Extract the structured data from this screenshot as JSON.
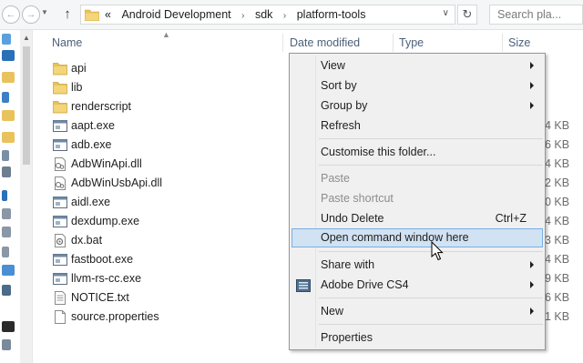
{
  "toolbar": {
    "back_glyph": "←",
    "forward_glyph": "→",
    "up_glyph": "↑",
    "breadcrumb_prefix": "«",
    "breadcrumbs": [
      "Android Development",
      "sdk",
      "platform-tools"
    ],
    "search_placeholder": "Search pla..."
  },
  "columns": {
    "name": "Name",
    "date": "Date modified",
    "type": "Type",
    "size": "Size"
  },
  "files": [
    {
      "name": "api",
      "kind": "folder",
      "size": ""
    },
    {
      "name": "lib",
      "kind": "folder",
      "size": ""
    },
    {
      "name": "renderscript",
      "kind": "folder",
      "size": ""
    },
    {
      "name": "aapt.exe",
      "kind": "exe",
      "size": "4 KB"
    },
    {
      "name": "adb.exe",
      "kind": "exe",
      "size": "6 KB"
    },
    {
      "name": "AdbWinApi.dll",
      "kind": "dll",
      "size": "4 KB"
    },
    {
      "name": "AdbWinUsbApi.dll",
      "kind": "dll",
      "size": "2 KB"
    },
    {
      "name": "aidl.exe",
      "kind": "exe",
      "size": "0 KB"
    },
    {
      "name": "dexdump.exe",
      "kind": "exe",
      "size": "4 KB"
    },
    {
      "name": "dx.bat",
      "kind": "bat",
      "size": "3 KB"
    },
    {
      "name": "fastboot.exe",
      "kind": "exe",
      "size": "4 KB"
    },
    {
      "name": "llvm-rs-cc.exe",
      "kind": "exe",
      "size": "9 KB"
    },
    {
      "name": "NOTICE.txt",
      "kind": "txt",
      "size": "6 KB"
    },
    {
      "name": "source.properties",
      "kind": "file",
      "size": "1 KB"
    }
  ],
  "context_menu": {
    "view": "View",
    "sort_by": "Sort by",
    "group_by": "Group by",
    "refresh": "Refresh",
    "customise": "Customise this folder...",
    "paste": "Paste",
    "paste_shortcut": "Paste shortcut",
    "undo_delete": "Undo Delete",
    "undo_shortcut": "Ctrl+Z",
    "open_cmd": "Open command window here",
    "share_with": "Share with",
    "adobe_drive": "Adobe Drive CS4",
    "new": "New",
    "properties": "Properties"
  },
  "colors": {
    "accent": "#78aee5",
    "highlight": "#d1e2f2",
    "folder": "#e8c25c",
    "header_text": "#4c607a"
  }
}
